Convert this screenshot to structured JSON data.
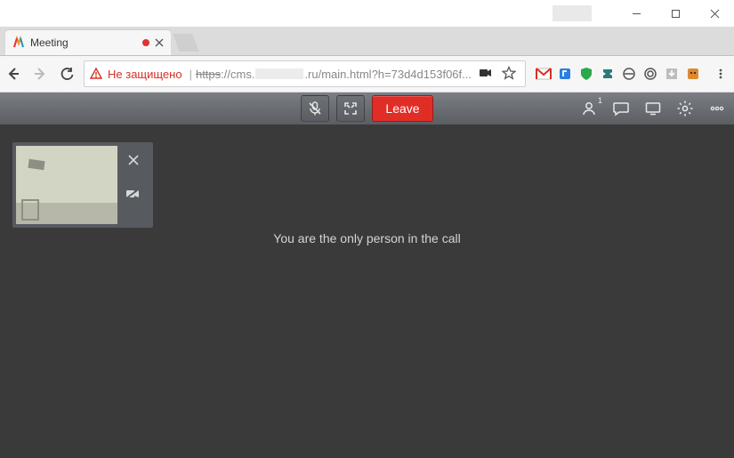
{
  "tab": {
    "title": "Meeting"
  },
  "addressBar": {
    "securityLabel": "Не защищено",
    "urlProtocol": "https",
    "urlPreRedact": "://cms.",
    "urlPostRedact": ".ru/main.html?h=73d4d153f06f..."
  },
  "meeting": {
    "toolbar": {
      "leaveLabel": "Leave",
      "participantBadge": "1"
    },
    "statusText": "You are the only person in the call"
  }
}
